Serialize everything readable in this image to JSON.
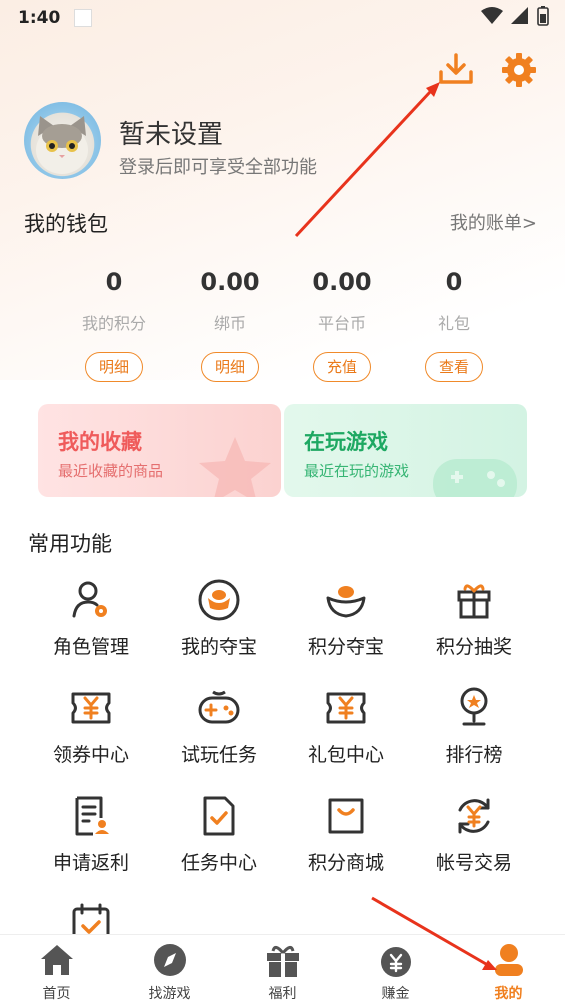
{
  "status_bar": {
    "time": "1:40"
  },
  "profile": {
    "name": "暂未设置",
    "subtitle": "登录后即可享受全部功能"
  },
  "wallet": {
    "title": "我的钱包",
    "bill_link": "我的账单>",
    "items": [
      {
        "value": "0",
        "label": "我的积分",
        "action": "明细"
      },
      {
        "value": "0.00",
        "label": "绑币",
        "action": "明细"
      },
      {
        "value": "0.00",
        "label": "平台币",
        "action": "充值"
      },
      {
        "value": "0",
        "label": "礼包",
        "action": "查看"
      }
    ]
  },
  "cards": {
    "favorites": {
      "title": "我的收藏",
      "subtitle": "最近收藏的商品"
    },
    "playing": {
      "title": "在玩游戏",
      "subtitle": "最近在玩的游戏"
    }
  },
  "functions": {
    "title": "常用功能",
    "items": [
      {
        "label": "角色管理",
        "icon": "role-manage-icon"
      },
      {
        "label": "我的夺宝",
        "icon": "my-treasure-icon"
      },
      {
        "label": "积分夺宝",
        "icon": "points-treasure-icon"
      },
      {
        "label": "积分抽奖",
        "icon": "gift-draw-icon"
      },
      {
        "label": "领券中心",
        "icon": "coupon-icon"
      },
      {
        "label": "试玩任务",
        "icon": "gamepad-icon"
      },
      {
        "label": "礼包中心",
        "icon": "gift-pack-icon"
      },
      {
        "label": "排行榜",
        "icon": "trophy-icon"
      },
      {
        "label": "申请返利",
        "icon": "rebate-doc-icon"
      },
      {
        "label": "任务中心",
        "icon": "task-doc-icon"
      },
      {
        "label": "积分商城",
        "icon": "shopping-bag-icon"
      },
      {
        "label": "帐号交易",
        "icon": "account-trade-icon"
      },
      {
        "label": "",
        "icon": "calendar-check-icon"
      }
    ]
  },
  "tabbar": {
    "tabs": [
      {
        "label": "首页",
        "icon": "home-icon"
      },
      {
        "label": "找游戏",
        "icon": "compass-icon"
      },
      {
        "label": "福利",
        "icon": "gift-icon"
      },
      {
        "label": "赚金",
        "icon": "money-bag-icon"
      },
      {
        "label": "我的",
        "icon": "user-icon",
        "active": true
      }
    ]
  },
  "colors": {
    "accent": "#f08020",
    "annotation_arrow": "#e8331c"
  }
}
